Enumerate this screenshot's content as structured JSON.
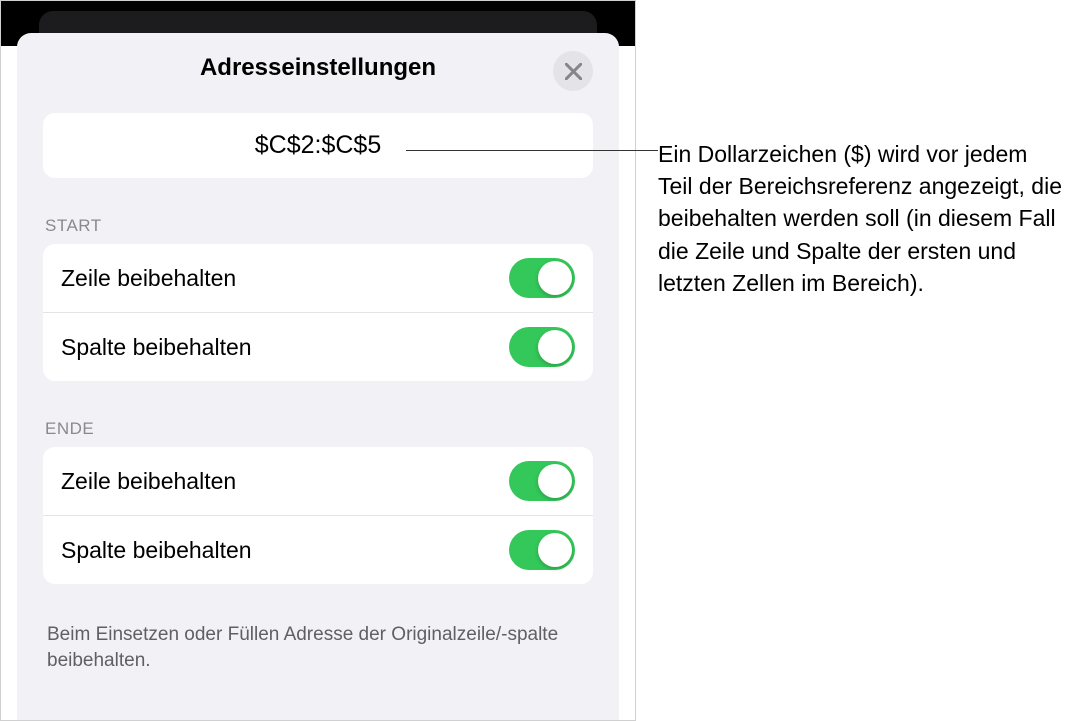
{
  "header": {
    "title": "Adresseinstellungen"
  },
  "formula": "$C$2:$C$5",
  "sections": {
    "start": {
      "label": "START",
      "rows": [
        {
          "label": "Zeile beibehalten",
          "on": true
        },
        {
          "label": "Spalte beibehalten",
          "on": true
        }
      ]
    },
    "end": {
      "label": "ENDE",
      "rows": [
        {
          "label": "Zeile beibehalten",
          "on": true
        },
        {
          "label": "Spalte beibehalten",
          "on": true
        }
      ]
    }
  },
  "footer": "Beim Einsetzen oder Füllen Adresse der Originalzeile/-spalte beibehalten.",
  "annotation": "Ein Dollarzeichen ($) wird vor jedem Teil der Bereichsreferenz angezeigt, die beibehalten werden soll (in diesem Fall die Zeile und Spalte der ersten und letzten Zellen im Bereich)."
}
